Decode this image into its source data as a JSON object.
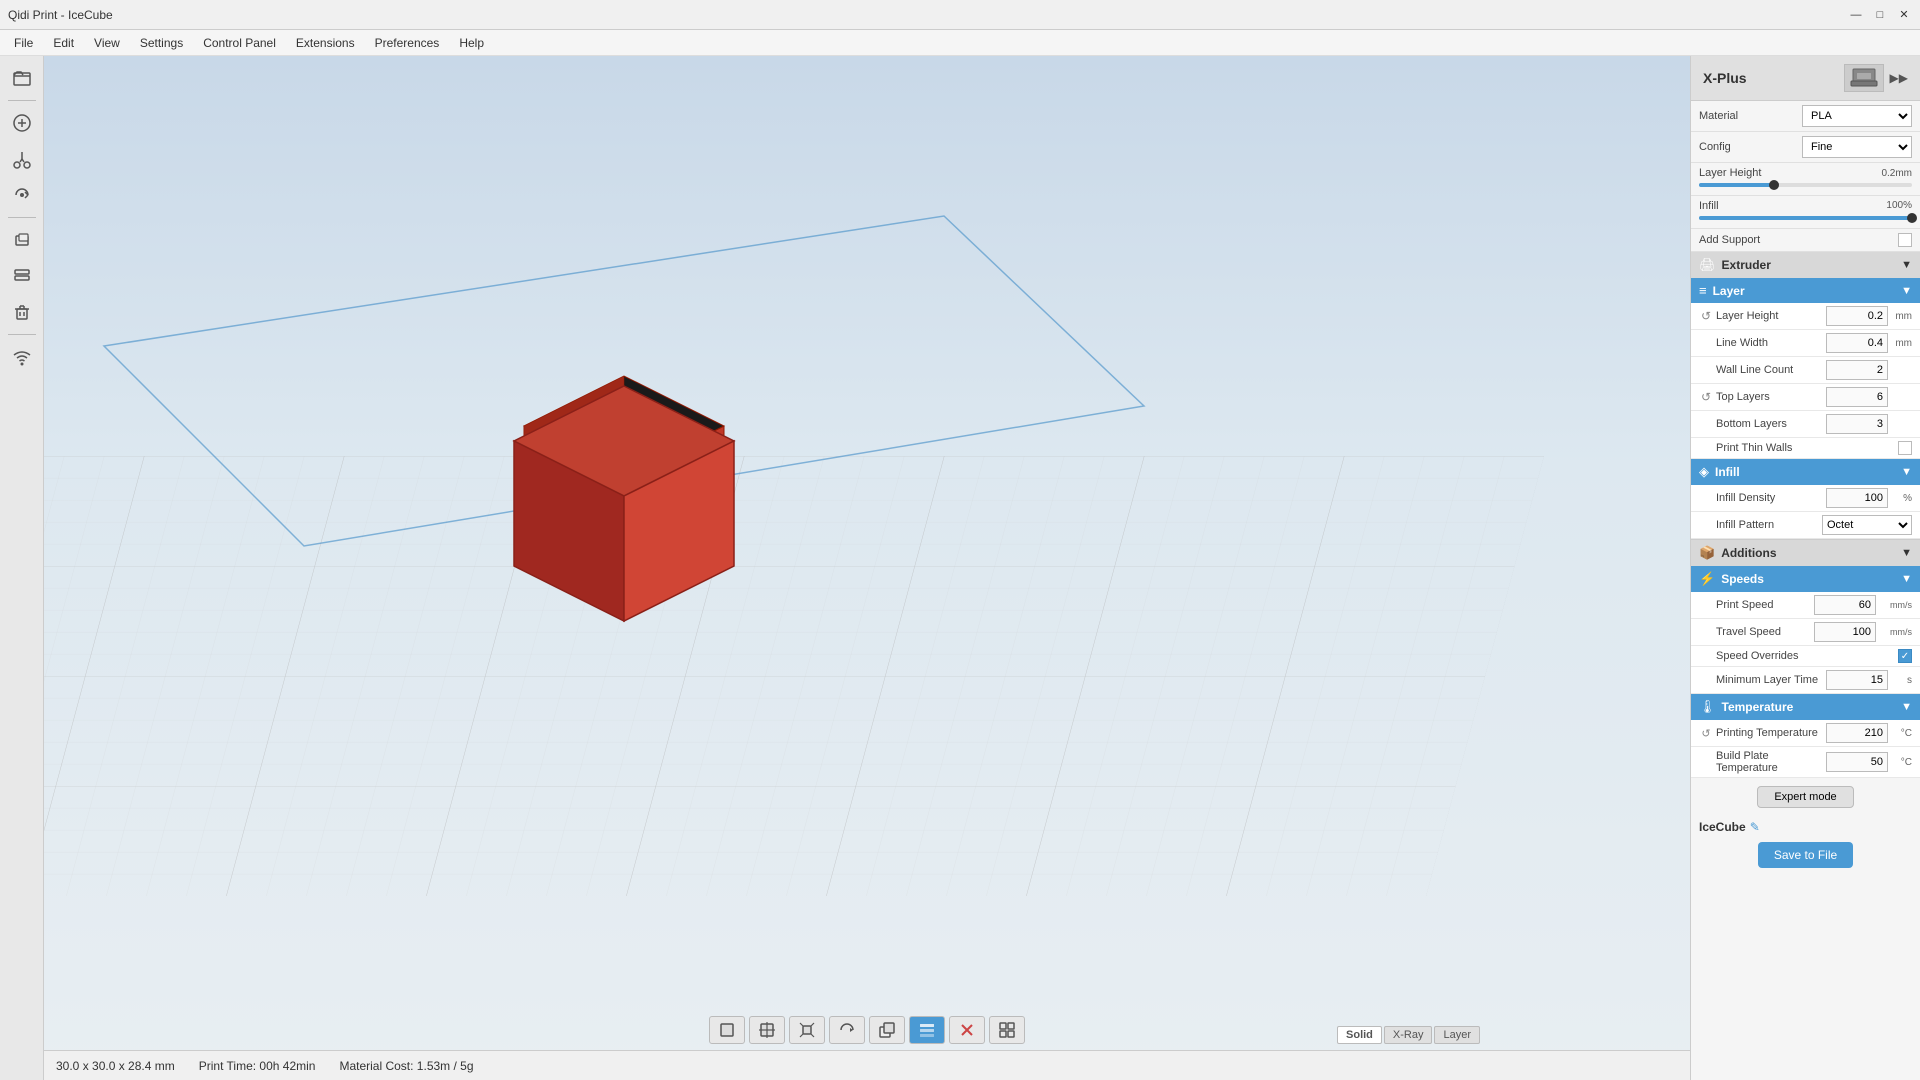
{
  "window": {
    "title": "Qidi Print - IceCube",
    "controls": {
      "minimize": "—",
      "maximize": "□",
      "close": "✕"
    }
  },
  "menu": {
    "items": [
      "File",
      "Edit",
      "View",
      "Settings",
      "Control Panel",
      "Extensions",
      "Preferences",
      "Help"
    ]
  },
  "toolbar": {
    "buttons": [
      "📁",
      "+",
      "✂",
      "⟳",
      "◻",
      "◻",
      "◻"
    ]
  },
  "panel": {
    "title": "X-Plus",
    "arrow": "▶▶",
    "material_label": "Material",
    "material_value": "PLA",
    "config_label": "Config",
    "config_value": "Fine",
    "layer_height_label": "Layer Height",
    "layer_height_value": "0.2mm",
    "layer_height_pct": 35,
    "infill_label": "Infill",
    "infill_value": "100%",
    "add_support_label": "Add Support",
    "sections": {
      "extruder": {
        "label": "Extruder",
        "icon": "🖨"
      },
      "layer": {
        "label": "Layer",
        "icon": "≡",
        "fields": {
          "layer_height": {
            "label": "Layer Height",
            "value": "0.2",
            "unit": "mm"
          },
          "line_width": {
            "label": "Line Width",
            "value": "0.4",
            "unit": "mm"
          },
          "wall_line_count": {
            "label": "Wall Line Count",
            "value": "2",
            "unit": ""
          },
          "top_layers": {
            "label": "Top Layers",
            "value": "6",
            "unit": ""
          },
          "bottom_layers": {
            "label": "Bottom Layers",
            "value": "3",
            "unit": ""
          },
          "print_thin_walls": {
            "label": "Print Thin Walls",
            "value": false
          }
        }
      },
      "infill": {
        "label": "Infill",
        "icon": "◈",
        "fields": {
          "infill_density": {
            "label": "Infill Density",
            "value": "100",
            "unit": "%"
          },
          "infill_pattern": {
            "label": "Infill Pattern",
            "value": "Octet"
          }
        }
      },
      "additions": {
        "label": "Additions",
        "icon": "+"
      },
      "speeds": {
        "label": "Speeds",
        "icon": "⚡",
        "fields": {
          "print_speed": {
            "label": "Print Speed",
            "value": "60",
            "unit": "mm/s"
          },
          "travel_speed": {
            "label": "Travel Speed",
            "value": "100",
            "unit": "mm/s"
          },
          "speed_overrides": {
            "label": "Speed Overrides",
            "value": true
          },
          "min_layer_time": {
            "label": "Minimum Layer Time",
            "value": "15",
            "unit": "s"
          }
        }
      },
      "temperature": {
        "label": "Temperature",
        "icon": "🌡",
        "fields": {
          "printing_temp": {
            "label": "Printing Temperature",
            "value": "210",
            "unit": "°C"
          },
          "build_plate_temp": {
            "label": "Build Plate Temperature",
            "value": "50",
            "unit": "°C"
          }
        }
      }
    },
    "expert_mode_label": "Expert mode",
    "icecube_label": "IceCube",
    "save_to_file_label": "Save to File"
  },
  "statusbar": {
    "dimensions": "30.0 x 30.0 x 28.4 mm",
    "print_time": "Print Time: 00h 42min",
    "material_cost": "Material Cost: 1.53m / 5g"
  },
  "view_modes": {
    "solid": "Solid",
    "xray": "X-Ray",
    "layer": "Layer"
  }
}
